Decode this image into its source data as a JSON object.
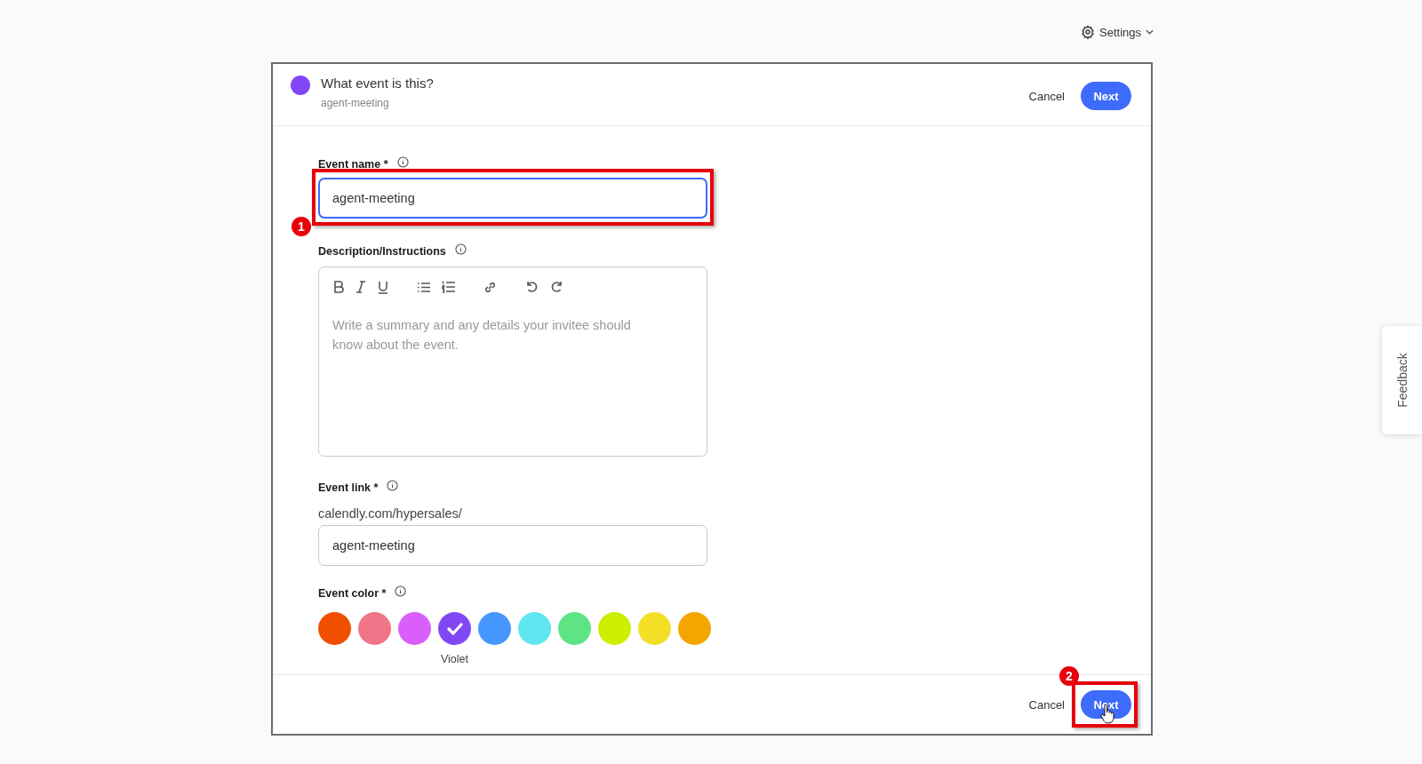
{
  "top_bar": {
    "settings_label": "Settings"
  },
  "header": {
    "title": "What event is this?",
    "subtitle": "agent-meeting",
    "cancel": "Cancel",
    "next": "Next"
  },
  "form": {
    "event_name": {
      "label": "Event name *",
      "value": "agent-meeting",
      "focused": true,
      "annotation": "1"
    },
    "description": {
      "label": "Description/Instructions",
      "placeholder": "Write a summary and any details your invitee should know about the event."
    },
    "event_link": {
      "label": "Event link *",
      "prefix": "calendly.com/hypersales/",
      "value": "agent-meeting"
    },
    "event_color": {
      "label": "Event color *",
      "selected_name": "Violet",
      "swatches": [
        {
          "color": "#f04f00",
          "selected": false
        },
        {
          "color": "#f07589",
          "selected": false
        },
        {
          "color": "#da5ffa",
          "selected": false
        },
        {
          "color": "#8247f5",
          "selected": true
        },
        {
          "color": "#4597ff",
          "selected": false
        },
        {
          "color": "#5fe6f0",
          "selected": false
        },
        {
          "color": "#5ee485",
          "selected": false
        },
        {
          "color": "#cdee00",
          "selected": false
        },
        {
          "color": "#f3df26",
          "selected": false
        },
        {
          "color": "#f3a500",
          "selected": false
        }
      ]
    }
  },
  "footer": {
    "cancel": "Cancel",
    "next": "Next",
    "annotation": "2"
  },
  "feedback_tab": {
    "label": "Feedback"
  }
}
